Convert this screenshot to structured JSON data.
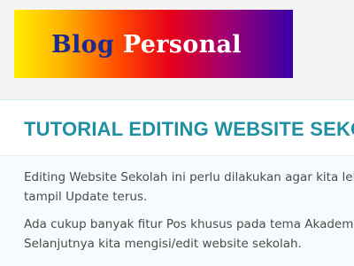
{
  "header": {
    "banner_word_1": "Blog",
    "banner_word_2": "Personal"
  },
  "article": {
    "title": "TUTORIAL EDITING WEBSITE SEKOLA",
    "paragraphs": [
      {
        "lines": [
          "Editing Website Sekolah ini perlu dilakukan agar kita lebih m",
          "tampil Update terus."
        ]
      },
      {
        "lines": [
          "Ada cukup banyak fitur Pos khusus pada tema Akademi ini",
          "Selanjutnya kita mengisi/edit website sekolah."
        ]
      }
    ]
  },
  "colors": {
    "title": "#1f8fa3",
    "body_text": "#4a4a4a",
    "banner_word_1": "#1b2a8c",
    "banner_word_2": "#ffffff"
  }
}
